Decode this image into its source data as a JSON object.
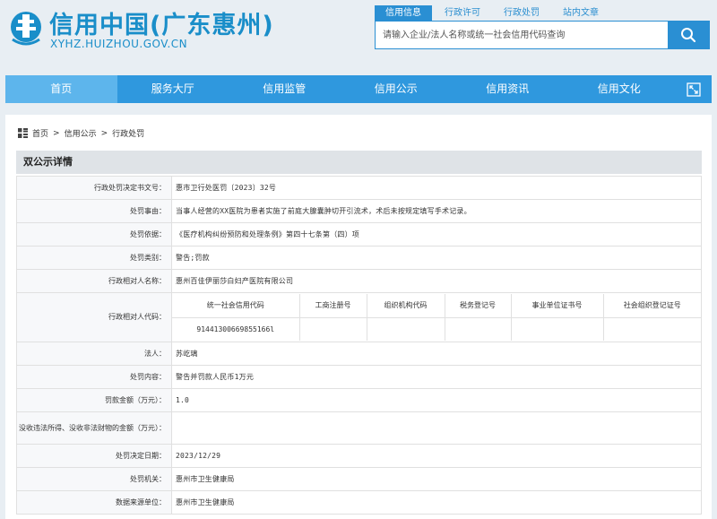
{
  "site": {
    "title": "信用中国(广东惠州)",
    "url": "XYHZ.HUIZHOU.GOV.CN",
    "brand_color": "#1a8ec9"
  },
  "search": {
    "tabs": [
      "信用信息",
      "行政许可",
      "行政处罚",
      "站内文章"
    ],
    "active_tab": "信用信息",
    "placeholder": "请输入企业/法人名称或统一社会信用代码查询",
    "button_icon": "search-icon"
  },
  "nav": {
    "items": [
      "首页",
      "服务大厅",
      "信用监管",
      "信用公示",
      "信用资讯",
      "信用文化"
    ],
    "active": "首页",
    "expand_icon": "fullscreen-icon",
    "bg_color": "#2f98de"
  },
  "breadcrumb": {
    "icon": "grid-icon",
    "items": [
      "首页",
      "信用公示",
      "行政处罚"
    ],
    "separator": ">"
  },
  "panel": {
    "title": "双公示详情"
  },
  "detail": {
    "decision_no": {
      "label": "行政处罚决定书文号：",
      "value": "惠市卫行处医罚〔2023〕32号"
    },
    "reason": {
      "label": "处罚事由：",
      "value": "当事人经营的XX医院为患者实施了前庭大腺囊肿切开引流术，术后未按规定填写手术记录。"
    },
    "basis": {
      "label": "处罚依据：",
      "value": "《医疗机构纠纷预防和处理条例》第四十七条第（四）项"
    },
    "category": {
      "label": "处罚类别：",
      "value": "警告;罚款"
    },
    "counterpart": {
      "label": "行政相对人名称：",
      "value": "惠州百佳伊丽莎白妇产医院有限公司"
    },
    "codes": {
      "label": "行政相对人代码：",
      "headers": [
        "统一社会信用代码",
        "工商注册号",
        "组织机构代码",
        "税务登记号",
        "事业单位证书号",
        "社会组织登记证号"
      ],
      "values": [
        "91441300669855166l",
        "",
        "",
        "",
        "",
        ""
      ]
    },
    "legal_rep": {
      "label": "法人：",
      "value": "苏屹璃"
    },
    "content": {
      "label": "处罚内容：",
      "value": "警告并罚款人民币1万元"
    },
    "fine": {
      "label": "罚款金额（万元）：",
      "value": "1.0"
    },
    "confiscation": {
      "label": "没收违法所得、没收非法财物的金额（万元）：",
      "value": ""
    },
    "date": {
      "label": "处罚决定日期：",
      "value": "2023/12/29"
    },
    "authority": {
      "label": "处罚机关：",
      "value": "惠州市卫生健康局"
    },
    "source": {
      "label": "数据来源单位：",
      "value": "惠州市卫生健康局"
    }
  }
}
